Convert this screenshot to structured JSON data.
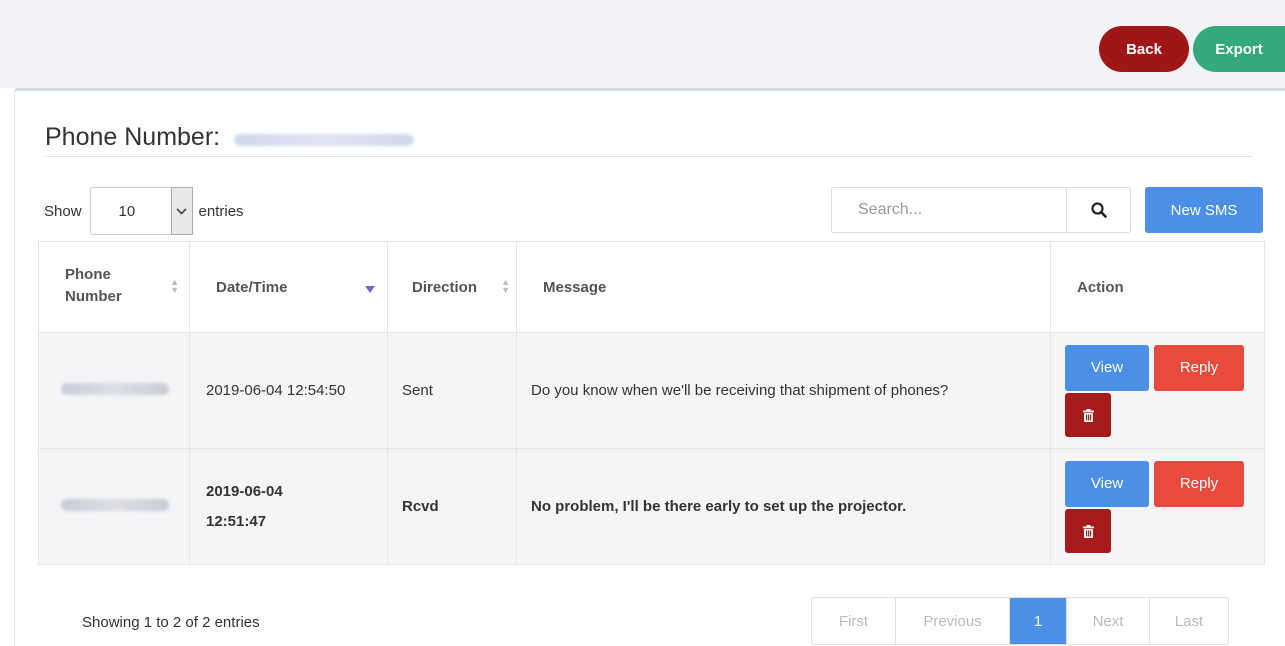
{
  "topbar": {
    "back_label": "Back",
    "export_label": "Export",
    "back_color": "#9f1616",
    "export_color": "#35a97b"
  },
  "page": {
    "title": "Phone Number:"
  },
  "length_menu": {
    "show_label": "Show",
    "value": "10",
    "entries_label": "entries"
  },
  "search": {
    "placeholder": "Search...",
    "icon": "search-icon"
  },
  "new_sms_label": "New SMS",
  "table": {
    "columns": [
      "Phone Number",
      "Date/Time",
      "Direction",
      "Message",
      "Action"
    ],
    "rows": [
      {
        "date_time": "2019-06-04 12:54:50",
        "direction": "Sent",
        "message": "Do you know when we'll be receiving that shipment of phones?",
        "view_label": "View",
        "reply_label": "Reply",
        "delete_icon": "trash-icon"
      },
      {
        "date_time": "2019-06-04 12:51:47",
        "direction": "Rcvd",
        "message": "No problem, I'll be there early to set up the projector.",
        "view_label": "View",
        "reply_label": "Reply",
        "delete_icon": "trash-icon"
      }
    ]
  },
  "info_text": "Showing 1 to 2 of 2 entries",
  "pagination": {
    "first": "First",
    "previous": "Previous",
    "current": "1",
    "next": "Next",
    "last": "Last"
  },
  "colors": {
    "primary": "#4b8fe6",
    "danger": "#e84a3c",
    "dark_danger": "#a51a1a"
  }
}
